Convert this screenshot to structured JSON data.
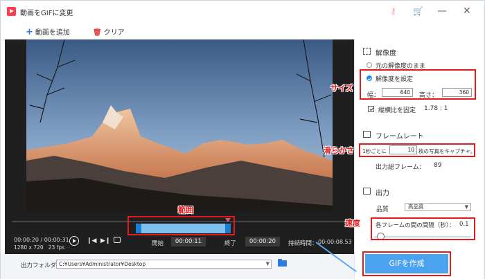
{
  "window": {
    "title": "動画をGIFに変更"
  },
  "toolbar": {
    "add_label": "動画を追加",
    "add_icon": "+",
    "clear_label": "クリア",
    "clear_icon": "🗑"
  },
  "player": {
    "current_time": "00:00:20 / 00:00:31",
    "resolution": "1280 x 720",
    "fps": "23 fps",
    "start_label": "開始",
    "start_value": "00:00:11",
    "end_label": "終了",
    "end_value": "00:00:20",
    "duration_label": "持続時間：",
    "duration_value": "00:00:08.53",
    "range_start_fraction": 0.355,
    "range_end_fraction": 0.645
  },
  "output": {
    "folder_label": "出力フォルダ：",
    "folder_path": "C:¥Users¥Administrator¥Desktop",
    "create_button": "GIFを作成"
  },
  "panel": {
    "resolution": {
      "title": "解像度",
      "keep_original": "元の解像度のまま",
      "set_custom": "解像度を設定",
      "width_label": "幅：",
      "width_value": "640",
      "height_label": "高さ：",
      "height_value": "360",
      "keep_ratio_label": "縦横比を固定",
      "ratio_value": "1.78 : 1"
    },
    "framerate": {
      "title": "フレームレート",
      "per_second_prefix": "1秒ごとに",
      "per_second_value": "10",
      "per_second_suffix": "枚の写真をキャプチャ。",
      "total_frames_label": "出力総フレーム：",
      "total_frames_value": "89"
    },
    "output": {
      "title": "出力",
      "quality_label": "品質",
      "quality_value": "高品質",
      "interval_label": "各フレームの間の間隔（秒）：",
      "interval_value": "0.1"
    }
  },
  "annotations": {
    "size": "サイズ",
    "smoothness": "滑らかさ",
    "range": "範囲",
    "speed": "速度"
  },
  "colors": {
    "accent": "#1a8fe6",
    "annotation": "#e8191b",
    "button": "#4ba3ef"
  }
}
